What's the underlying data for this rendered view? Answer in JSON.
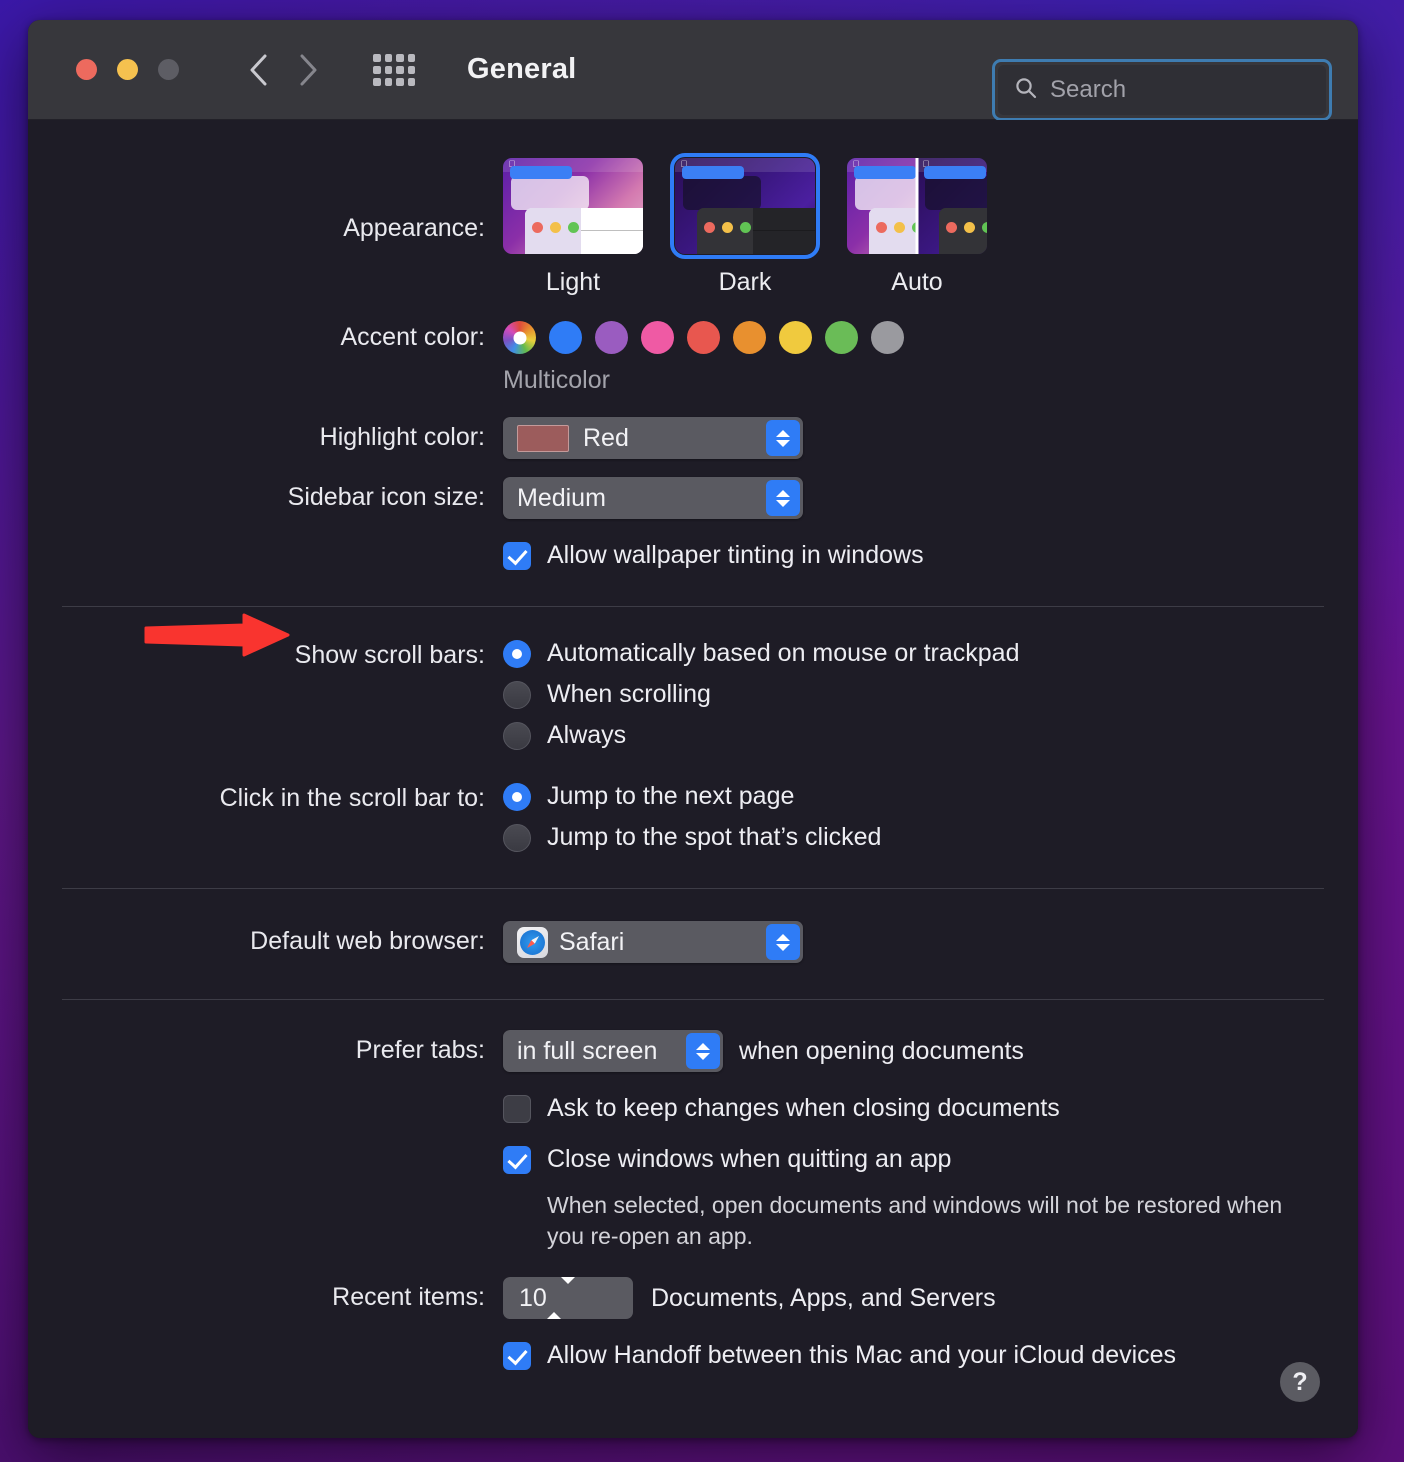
{
  "window": {
    "title": "General",
    "traffic_lights": [
      "close-button",
      "minimize-button",
      "zoom-button"
    ],
    "back_label": "Back",
    "forward_label": "Forward",
    "grid_label": "Show All"
  },
  "search": {
    "placeholder": "Search",
    "value": "",
    "icon": "search-icon"
  },
  "appearance": {
    "label": "Appearance:",
    "options": [
      {
        "label": "Light",
        "selected": false
      },
      {
        "label": "Dark",
        "selected": true
      },
      {
        "label": "Auto",
        "selected": false
      }
    ]
  },
  "accent_color": {
    "label": "Accent color:",
    "caption": "Multicolor",
    "selected_index": 0,
    "swatches": [
      {
        "name": "multicolor",
        "hex": "multicolor"
      },
      {
        "name": "blue",
        "hex": "#2f7cf6"
      },
      {
        "name": "purple",
        "hex": "#9a5cc0"
      },
      {
        "name": "pink",
        "hex": "#ef5aa4"
      },
      {
        "name": "red",
        "hex": "#e8574f"
      },
      {
        "name": "orange",
        "hex": "#e8902f"
      },
      {
        "name": "yellow",
        "hex": "#f0ca3e"
      },
      {
        "name": "green",
        "hex": "#6abc57"
      },
      {
        "name": "graphite",
        "hex": "#9a9a9f"
      }
    ]
  },
  "highlight_color": {
    "label": "Highlight color:",
    "value": "Red",
    "swatch_hex": "#9c5c5c"
  },
  "sidebar_icon_size": {
    "label": "Sidebar icon size:",
    "value": "Medium"
  },
  "wallpaper_tinting": {
    "label": "Allow wallpaper tinting in windows",
    "checked": true
  },
  "show_scroll_bars": {
    "label": "Show scroll bars:",
    "options": [
      {
        "label": "Automatically based on mouse or trackpad",
        "selected": true
      },
      {
        "label": "When scrolling",
        "selected": false
      },
      {
        "label": "Always",
        "selected": false
      }
    ]
  },
  "click_scroll_bar": {
    "label": "Click in the scroll bar to:",
    "options": [
      {
        "label": "Jump to the next page",
        "selected": true
      },
      {
        "label": "Jump to the spot that’s clicked",
        "selected": false
      }
    ]
  },
  "default_browser": {
    "label": "Default web browser:",
    "value": "Safari",
    "icon": "safari-icon"
  },
  "prefer_tabs": {
    "label": "Prefer tabs:",
    "value": "in full screen",
    "suffix": "when opening documents"
  },
  "ask_keep_changes": {
    "label": "Ask to keep changes when closing documents",
    "checked": false
  },
  "close_windows": {
    "label": "Close windows when quitting an app",
    "checked": true,
    "description": "When selected, open documents and windows will not be restored when you re-open an app."
  },
  "recent_items": {
    "label": "Recent items:",
    "value": "10",
    "suffix": "Documents, Apps, and Servers"
  },
  "handoff": {
    "label": "Allow Handoff between this Mac and your iCloud devices",
    "checked": true
  },
  "help": {
    "label": "?"
  },
  "annotation": {
    "type": "red-arrow",
    "color": "#f9342f",
    "points_at": "Show scroll bars:"
  }
}
